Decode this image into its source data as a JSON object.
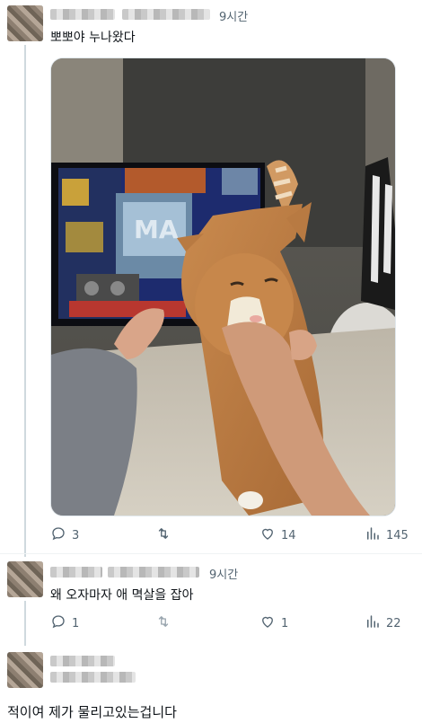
{
  "posts": [
    {
      "time": "9시간",
      "text": "뽀뽀야 누나왔다",
      "stats": {
        "replies": "3",
        "reposts": "",
        "likes": "14",
        "views": "145"
      }
    },
    {
      "time": "9시간",
      "text": "왜 오자마자 애 멱살을 잡아",
      "stats": {
        "replies": "1",
        "reposts": "",
        "likes": "1",
        "views": "22"
      }
    },
    {
      "time": "",
      "text": "적이여 제가 물리고있는겁니다"
    }
  ],
  "icons": {
    "reply": "speech-bubble",
    "repost": "repost-arrows",
    "like": "heart",
    "views": "bar-chart"
  },
  "colors": {
    "icon_gray": "#536471",
    "thread_line": "#cfd9de"
  }
}
